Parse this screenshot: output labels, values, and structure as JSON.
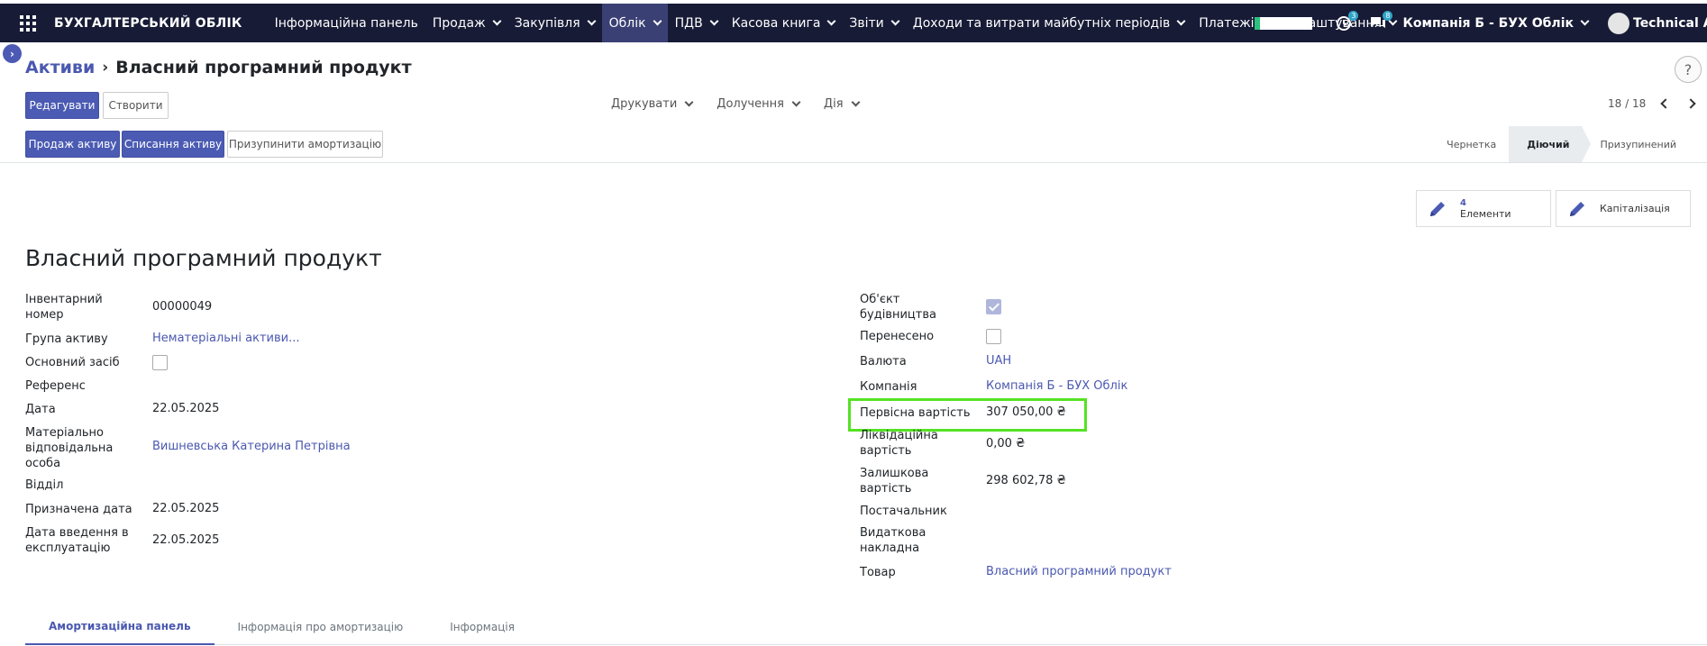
{
  "topbar": {
    "brand": "БУХГАЛТЕРСЬКИЙ ОБЛІК",
    "menu": [
      {
        "label": "Інформаційна панель",
        "dropdown": false,
        "active": false
      },
      {
        "label": "Продаж",
        "dropdown": true,
        "active": false
      },
      {
        "label": "Закупівля",
        "dropdown": true,
        "active": false
      },
      {
        "label": "Облік",
        "dropdown": true,
        "active": true
      },
      {
        "label": "ПДВ",
        "dropdown": true,
        "active": false
      },
      {
        "label": "Касова книга",
        "dropdown": true,
        "active": false
      },
      {
        "label": "Звіти",
        "dropdown": true,
        "active": false
      },
      {
        "label": "Доходи та витрати майбутніх періодів",
        "dropdown": true,
        "active": false
      },
      {
        "label": "Платежі",
        "dropdown": true,
        "active": false
      },
      {
        "label": "Налаштування",
        "dropdown": true,
        "active": false
      }
    ],
    "activity_count": "3",
    "messages_count": "8",
    "company": "Компанія Б - БУХ Облік",
    "user": "Technical Adr"
  },
  "breadcrumb": {
    "parent": "Активи",
    "current": "Власний програмний продукт"
  },
  "help_label": "?",
  "buttons": {
    "edit": "Редагувати",
    "create": "Створити",
    "sell_asset": "Продаж активу",
    "dispose_asset": "Списання активу",
    "pause_depreciation": "Призупинити амортизацію"
  },
  "dropdowns": [
    "Друкувати",
    "Долучення",
    "Дія"
  ],
  "pager": {
    "value": "18 / 18"
  },
  "status": {
    "stages": [
      "Чернетка",
      "Діючий",
      "Призупинений"
    ],
    "current": "Діючий"
  },
  "smart_buttons": [
    {
      "value": "4",
      "label": "Елементи"
    },
    {
      "value": "",
      "label": "Капіталізація"
    }
  ],
  "record": {
    "title": "Власний програмний продукт",
    "left": {
      "inventory_number_label": "Інвентарний номер",
      "inventory_number": "00000049",
      "asset_group_label": "Група активу",
      "asset_group": "Нематеріальні активи...",
      "fixed_asset_label": "Основний засіб",
      "fixed_asset": false,
      "reference_label": "Референс",
      "date_label": "Дата",
      "date": "22.05.2025",
      "responsible_label": "Матеріально відповідальна особа",
      "responsible": "Вишневська Катерина Петрівна",
      "department_label": "Відділ",
      "assigned_date_label": "Призначена дата",
      "assigned_date": "22.05.2025",
      "commissioning_date_label": "Дата введення в експлуатацію",
      "commissioning_date": "22.05.2025"
    },
    "right": {
      "construction_label": "Об'єкт будівництва",
      "construction": true,
      "transferred_label": "Перенесено",
      "transferred": false,
      "currency_label": "Валюта",
      "currency": "UAH",
      "company_label": "Компанія",
      "company": "Компанія Б - БУХ Облік",
      "initial_value_label": "Первісна вартість",
      "initial_value": "307 050,00 ₴",
      "salvage_value_label": "Ліквідаційна вартість",
      "salvage_value": "0,00 ₴",
      "residual_value_label": "Залишкова вартість",
      "residual_value": "298 602,78 ₴",
      "vendor_label": "Постачальник",
      "invoice_label": "Видаткова накладна",
      "product_label": "Товар",
      "product": "Власний програмний продукт"
    }
  },
  "tabs": [
    {
      "label": "Амортизаційна панель",
      "active": true
    },
    {
      "label": "Інформація про амортизацію",
      "active": false
    },
    {
      "label": "Інформація",
      "active": false
    }
  ],
  "colors": {
    "topbar": "#171b36",
    "primary": "#4b5bb3",
    "link": "#4a58b0",
    "highlight": "#55e224"
  }
}
